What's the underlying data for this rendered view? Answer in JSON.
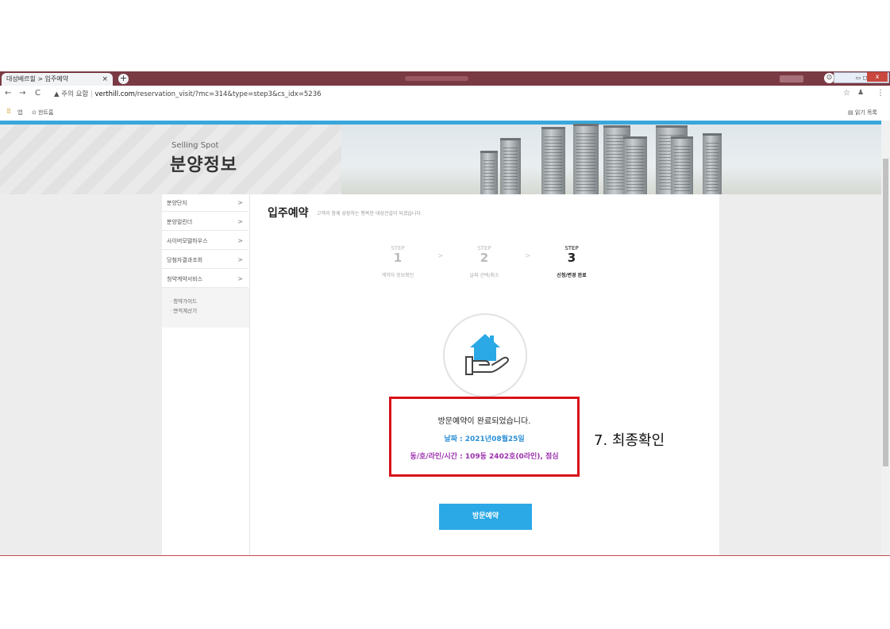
{
  "browser": {
    "tab_title": "대성베르힐 > 입주예약",
    "tab_close": "×",
    "new_tab": "+",
    "nav_back": "←",
    "nav_forward": "→",
    "nav_reload": "C",
    "security_warning": "▲ 주의 요함",
    "url_domain": "verthill.com",
    "url_path": "/reservation_visit/?mc=314&type=step3&cs_idx=5236",
    "star_glyph": "☆",
    "account_glyph": "♟",
    "menu_glyph": "⋮",
    "profile_glyph": "⊙",
    "apps_glyph": "⠿",
    "bookmark_apps": "앱",
    "bookmark_1": "⊙ 한트홈",
    "reading_list": "읽기 목록",
    "window_close": "x",
    "window_controls": "▭ ◻"
  },
  "banner": {
    "subtitle": "Selling Spot",
    "title": "분양정보"
  },
  "sidebar": {
    "items": [
      {
        "label": "분양단지",
        "chev": ">"
      },
      {
        "label": "분양컬린더",
        "chev": ">"
      },
      {
        "label": "사이버모델하우스",
        "chev": ">"
      },
      {
        "label": "당첨자결과조회",
        "chev": ">"
      },
      {
        "label": "청약계약서비스",
        "chev": ">"
      }
    ],
    "sub_items": [
      {
        "bullet": "·",
        "label": "청약가이드"
      },
      {
        "bullet": "·",
        "label": "면적계산기"
      }
    ]
  },
  "main": {
    "title": "입주예약",
    "description": "고객과 함께 성장하는 행복한 대성건설이 되겠습니다.",
    "steps": [
      {
        "label": "STEP",
        "number": "1",
        "caption": "계약자 정보확인"
      },
      {
        "label": "STEP",
        "number": "2",
        "caption": "날짜 선택/취소"
      },
      {
        "label": "STEP",
        "number": "3",
        "caption": "신청/변경 완료"
      }
    ],
    "step_arrow": ">",
    "complete_message": "방문예약이 완료되었습니다.",
    "date_line": "날짜 : 2021년08월25일",
    "unit_line": "동/호/라인/시간 : 109동 2402호(0라인), 점심",
    "visit_button": "방문예약"
  },
  "annotation": "7. 최종확인",
  "colors": {
    "accent": "#2ba9e6",
    "highlight_box": "#d8101a",
    "date_text": "#2b8fd6",
    "unit_text": "#9b2fae",
    "titlebar": "#7a3a44"
  },
  "icons": [
    "house-in-hand-icon",
    "star-icon",
    "account-icon",
    "menu-icon",
    "apps-icon",
    "reading-list-icon"
  ]
}
